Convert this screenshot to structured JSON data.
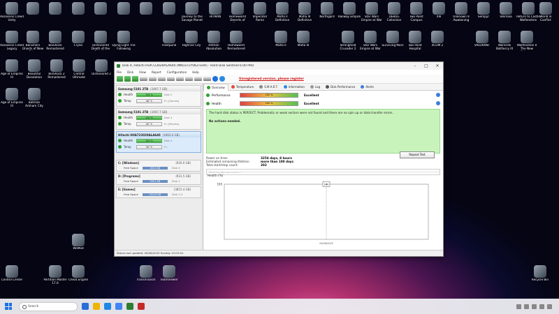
{
  "desktop": {
    "row1": [
      "Assassins Creed Unity",
      "",
      "",
      "",
      "",
      "",
      "",
      "",
      "",
      "Journey to the Savage Planet",
      "HITMAN",
      "Homeworld Deserts of Kharak",
      "Imperator Rome",
      "Mafia II Definitive",
      "Mafia III Definitive",
      "Northgard",
      "Railway Empire",
      "Star Wars Empire at War",
      "DEBUG Collection",
      "Two Point Campus",
      "XIII",
      "Unknown 9 Awakening",
      "Sempyr",
      "Sternaia",
      "Return to Castle Wolfenstein",
      "World in Conflict"
    ],
    "row2": [
      "Assassins Creed Legacy",
      "Banishers Ghosts of New Eden",
      "BioShock Remastered",
      "Crysis",
      "Dishonored Death of the Outsider",
      "Dying Light The Following",
      "",
      "Frostpunk",
      "Highrise City",
      "Hitman Absolution",
      "Homeworld Remastered",
      "",
      "",
      "Mafia II",
      "Mafia III",
      "",
      "Stronghold Crusader 2",
      "Star Wars Empire at War",
      "Surviving Mars",
      "Two Point Hospital",
      "XCOM 2",
      "",
      "VALORANT",
      "Warlords Battlecry III",
      "Wolfenstein II The New Colossus"
    ],
    "row3": [
      "Age of Empires III",
      "Beautiful Desolation",
      "BioShock 2 Remastered",
      "Control Ultimate",
      "Dishonored 2"
    ],
    "row4": [
      "Age of Empires III",
      "Batman Arkham City"
    ],
    "lower": [
      {
        "name": "WeMod"
      },
      {
        "name": "Control Center"
      },
      {
        "name": "Partition Master 17.0"
      },
      {
        "name": "Cheat Engine"
      },
      {
        "name": "Transmission"
      },
      {
        "name": "TeamViewer"
      },
      {
        "name": "Recycle Bin"
      }
    ]
  },
  "window": {
    "title": "Disk 4, Hitachi HUA723020ALA640 [MK0371YVK2TE0A] - Hard Disk Sentinel 6.00 PRO",
    "menu": [
      "File",
      "Disk",
      "View",
      "Report",
      "Configuration",
      "Help"
    ],
    "unregistered": "Unregistered version, please register",
    "disks": [
      {
        "name": "Samsung 5101 2TB",
        "size": "(1907.7 GB)",
        "health": "100 %",
        "temp": "46 °C",
        "disk": "Disk 2",
        "extra": "E:\\ [Games]"
      },
      {
        "name": "Samsung 5101 2TB",
        "size": "(1907.7 GB)",
        "health": "100 %",
        "temp": "40 °C",
        "disk": "Disk 3",
        "extra": "E:\\ [Movies]"
      },
      {
        "name": "Hitachi HUA723020ALA640",
        "size": "(1863.0 GB)",
        "health": "100 %",
        "temp": "39 °C",
        "disk": "Disk 4",
        "extra": "F:\\"
      }
    ],
    "health_label": "Health",
    "temp_label": "Temp",
    "free_label": "Free Space",
    "partitions": [
      {
        "name": "C: [Windows]",
        "size": "(930.0 GB)",
        "free": "283.6 GB",
        "disk": "Disk 0"
      },
      {
        "name": "D: [Programs]",
        "size": "(931.5 GB)",
        "free": "226.2 GB",
        "disk": "Disk 1"
      },
      {
        "name": "E: [Games]",
        "size": "(3815.4 GB)",
        "free": "1424.8 GB",
        "disk": "Disk 2,3"
      }
    ],
    "tabs": [
      "Overview",
      "Temperature",
      "S.M.A.R.T.",
      "Information",
      "Log",
      "Disk Performance",
      "Alerts"
    ],
    "performance_label": "Performance",
    "performance_value": "100 %",
    "performance_text": "Excellent",
    "health_main_label": "Health",
    "health_value": "100 %",
    "health_text": "Excellent",
    "status_text": "The hard disk status is PERFECT. Problematic or weak sectors were not found and there are no spin up or data transfer errors.",
    "no_actions": "No actions needed.",
    "power_on_label": "Power on time:",
    "power_on_value": "3254 days, 8 hours",
    "lifetime_label": "Estimated remaining lifetime:",
    "lifetime_value": "more than 100 days",
    "startstop_label": "Total start/stop count:",
    "startstop_value": "202",
    "repeat_label": "Repeat Test",
    "comment_placeholder": "Click to add comment ...",
    "chart_title": "Health (%)",
    "status_bar": "Status last updated: 09/06/2025 Sunday 15:03:54"
  },
  "chart_data": {
    "type": "line",
    "title": "Health (%)",
    "x": [
      "09/06/2025"
    ],
    "values": [
      100
    ],
    "ylim": [
      0,
      100
    ],
    "ylabel": "100",
    "xlabel": ""
  },
  "taskbar": {
    "search_placeholder": "Search"
  },
  "colors": {
    "accent": "#1a73e8",
    "good": "#2ea02e",
    "status_bg": "#c8f4bc",
    "warn": "#d01010"
  }
}
